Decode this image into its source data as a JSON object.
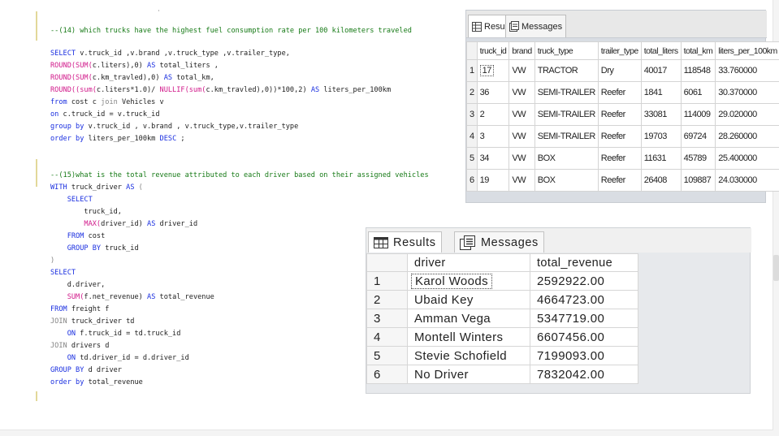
{
  "editor": {
    "lines": [
      {
        "parts": [
          {
            "t": "--(14) which trucks have the highest fuel consumption rate per 100 kilometers traveled",
            "c": "comment"
          }
        ]
      },
      {
        "parts": [
          {
            "t": "SELECT ",
            "c": "kw"
          },
          {
            "t": "v.truck_id ,v.brand ,v.truck_type ,v.trailer_type,",
            "c": ""
          }
        ]
      },
      {
        "parts": [
          {
            "t": "ROUND(",
            "c": "fn"
          },
          {
            "t": "SUM(",
            "c": "fn"
          },
          {
            "t": "c.liters),0) ",
            "c": ""
          },
          {
            "t": "AS ",
            "c": "kw"
          },
          {
            "t": "total_liters ,",
            "c": ""
          }
        ]
      },
      {
        "parts": [
          {
            "t": "ROUND(",
            "c": "fn"
          },
          {
            "t": "SUM(",
            "c": "fn"
          },
          {
            "t": "c.km_travled),0) ",
            "c": ""
          },
          {
            "t": "AS ",
            "c": "kw"
          },
          {
            "t": "total_km,",
            "c": ""
          }
        ]
      },
      {
        "parts": [
          {
            "t": "ROUND((",
            "c": "fn"
          },
          {
            "t": "sum(",
            "c": "fn"
          },
          {
            "t": "c.liters*1.0)/ ",
            "c": ""
          },
          {
            "t": "NULLIF(",
            "c": "fn"
          },
          {
            "t": "sum(",
            "c": "fn"
          },
          {
            "t": "c.km_travled),0))*100,2) ",
            "c": ""
          },
          {
            "t": "AS ",
            "c": "kw"
          },
          {
            "t": "liters_per_100km",
            "c": ""
          }
        ]
      },
      {
        "parts": [
          {
            "t": "from ",
            "c": "kw"
          },
          {
            "t": "cost c ",
            "c": ""
          },
          {
            "t": "join ",
            "c": "gray"
          },
          {
            "t": "Vehicles v",
            "c": ""
          }
        ]
      },
      {
        "parts": [
          {
            "t": "on ",
            "c": "kw"
          },
          {
            "t": "c.truck_id = v.truck_id",
            "c": ""
          }
        ]
      },
      {
        "parts": [
          {
            "t": "group by ",
            "c": "kw"
          },
          {
            "t": "v.truck_id , v.brand , v.truck_type,v.trailer_type",
            "c": ""
          }
        ]
      },
      {
        "parts": [
          {
            "t": "order by ",
            "c": "kw"
          },
          {
            "t": "liters_per_100km ",
            "c": ""
          },
          {
            "t": "DESC ",
            "c": "kw"
          },
          {
            "t": ";",
            "c": ""
          }
        ]
      },
      {
        "parts": [
          {
            "t": "--(15)what is the total revenue attributed to each driver based on their assigned vehicles",
            "c": "comment"
          }
        ]
      },
      {
        "parts": [
          {
            "t": "WITH ",
            "c": "kw"
          },
          {
            "t": "truck_driver ",
            "c": ""
          },
          {
            "t": "AS ",
            "c": "kw"
          },
          {
            "t": "(",
            "c": "gray"
          }
        ]
      },
      {
        "parts": [
          {
            "t": "    SELECT",
            "c": "kw"
          }
        ]
      },
      {
        "parts": [
          {
            "t": "        truck_id,",
            "c": ""
          }
        ]
      },
      {
        "parts": [
          {
            "t": "        MAX(",
            "c": "fn"
          },
          {
            "t": "driver_id) ",
            "c": ""
          },
          {
            "t": "AS ",
            "c": "kw"
          },
          {
            "t": "driver_id",
            "c": ""
          }
        ]
      },
      {
        "parts": [
          {
            "t": "    FROM ",
            "c": "kw"
          },
          {
            "t": "cost",
            "c": ""
          }
        ]
      },
      {
        "parts": [
          {
            "t": "    GROUP BY ",
            "c": "kw"
          },
          {
            "t": "truck_id",
            "c": ""
          }
        ]
      },
      {
        "parts": [
          {
            "t": ")",
            "c": "gray"
          }
        ]
      },
      {
        "parts": [
          {
            "t": "SELECT",
            "c": "kw"
          }
        ]
      },
      {
        "parts": [
          {
            "t": "    d.driver,",
            "c": ""
          }
        ]
      },
      {
        "parts": [
          {
            "t": "    SUM(",
            "c": "fn"
          },
          {
            "t": "f.net_revenue) ",
            "c": ""
          },
          {
            "t": "AS ",
            "c": "kw"
          },
          {
            "t": "total_revenue",
            "c": ""
          }
        ]
      },
      {
        "parts": [
          {
            "t": "FROM ",
            "c": "kw"
          },
          {
            "t": "freight f",
            "c": ""
          }
        ]
      },
      {
        "parts": [
          {
            "t": "JOIN ",
            "c": "gray"
          },
          {
            "t": "truck_driver td",
            "c": ""
          }
        ]
      },
      {
        "parts": [
          {
            "t": "    ON ",
            "c": "kw"
          },
          {
            "t": "f.truck_id = td.truck_id",
            "c": ""
          }
        ]
      },
      {
        "parts": [
          {
            "t": "JOIN ",
            "c": "gray"
          },
          {
            "t": "drivers d",
            "c": ""
          }
        ]
      },
      {
        "parts": [
          {
            "t": "    ON ",
            "c": "kw"
          },
          {
            "t": "td.driver_id = d.driver_id",
            "c": ""
          }
        ]
      },
      {
        "parts": [
          {
            "t": "GROUP BY ",
            "c": "kw"
          },
          {
            "t": "d driver",
            "c": ""
          }
        ]
      },
      {
        "parts": [
          {
            "t": "order by ",
            "c": "kw"
          },
          {
            "t": "total_revenue",
            "c": ""
          }
        ]
      }
    ]
  },
  "results_top": {
    "tabs": [
      {
        "label": "Results",
        "icon": "grid-icon"
      },
      {
        "label": "Messages",
        "icon": "messages-icon"
      }
    ],
    "columns": [
      "truck_id",
      "brand",
      "truck_type",
      "trailer_type",
      "total_liters",
      "total_km",
      "liters_per_100km"
    ],
    "rows": [
      {
        "n": "1",
        "cells": [
          "17",
          "VW",
          "TRACTOR",
          "Dry",
          "40017",
          "118548",
          "33.760000"
        ]
      },
      {
        "n": "2",
        "cells": [
          "36",
          "VW",
          "SEMI-TRAILER",
          "Reefer",
          "1841",
          "6061",
          "30.370000"
        ]
      },
      {
        "n": "3",
        "cells": [
          "2",
          "VW",
          "SEMI-TRAILER",
          "Reefer",
          "33081",
          "114009",
          "29.020000"
        ]
      },
      {
        "n": "4",
        "cells": [
          "3",
          "VW",
          "SEMI-TRAILER",
          "Reefer",
          "19703",
          "69724",
          "28.260000"
        ]
      },
      {
        "n": "5",
        "cells": [
          "34",
          "VW",
          "BOX",
          "Reefer",
          "11631",
          "45789",
          "25.400000"
        ]
      },
      {
        "n": "6",
        "cells": [
          "19",
          "VW",
          "BOX",
          "Reefer",
          "26408",
          "109887",
          "24.030000"
        ]
      }
    ]
  },
  "results_bottom": {
    "tabs": [
      {
        "label": "Results",
        "icon": "grid-icon"
      },
      {
        "label": "Messages",
        "icon": "messages-icon"
      }
    ],
    "columns": [
      "driver",
      "total_revenue"
    ],
    "rows": [
      {
        "n": "1",
        "cells": [
          "Karol Woods",
          "2592922.00"
        ]
      },
      {
        "n": "2",
        "cells": [
          "Ubaid Key",
          "4664723.00"
        ]
      },
      {
        "n": "3",
        "cells": [
          "Amman Vega",
          "5347719.00"
        ]
      },
      {
        "n": "4",
        "cells": [
          "Montell Winters",
          "6607456.00"
        ]
      },
      {
        "n": "5",
        "cells": [
          "Stevie Schofield",
          "7199093.00"
        ]
      },
      {
        "n": "6",
        "cells": [
          "No Driver",
          "7832042.00"
        ]
      }
    ]
  }
}
